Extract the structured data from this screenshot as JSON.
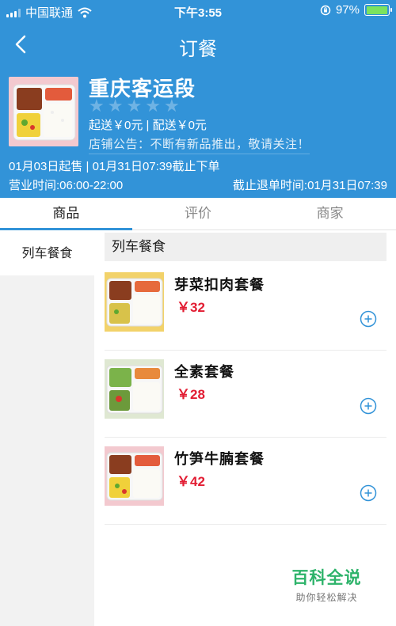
{
  "status_bar": {
    "carrier": "中国联通",
    "time": "下午3:55",
    "battery_percent": "97%",
    "battery_level": 0.97
  },
  "nav": {
    "title": "订餐",
    "back_icon": "back-arrow-icon"
  },
  "shop": {
    "name": "重庆客运段",
    "rating": 0,
    "rating_max": 5,
    "fees": "起送￥0元 | 配送￥0元",
    "notice": "店铺公告：不断有新品推出，敬请关注！",
    "sale_dates": "01月03日起售 | 01月31日07:39截止下单",
    "hours": "营业时间:06:00-22:00",
    "cutoff": "截止退单时间:01月31日07:39"
  },
  "tabs": [
    {
      "label": "商品",
      "active": true
    },
    {
      "label": "评价",
      "active": false
    },
    {
      "label": "商家",
      "active": false
    }
  ],
  "sidebar": {
    "categories": [
      {
        "label": "列车餐食",
        "active": true
      }
    ]
  },
  "section": {
    "title": "列车餐食"
  },
  "items": [
    {
      "name": "芽菜扣肉套餐",
      "price": "￥32"
    },
    {
      "name": "全素套餐",
      "price": "￥28"
    },
    {
      "name": "竹笋牛腩套餐",
      "price": "￥42"
    }
  ],
  "watermark": {
    "title": "百科全说",
    "subtitle": "助你轻松解决"
  },
  "colors": {
    "accent": "#3293d8",
    "price": "#e21d33",
    "watermark": "#2db36a"
  }
}
